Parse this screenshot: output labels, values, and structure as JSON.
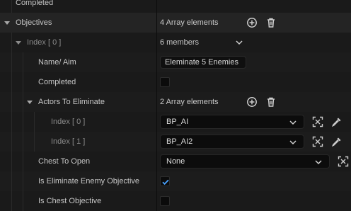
{
  "rows": {
    "completed_top": {
      "label": "Completed"
    },
    "objectives": {
      "label": "Objectives",
      "value": "4 Array elements"
    },
    "index0": {
      "label": "Index [ 0 ]",
      "value": "6 members"
    },
    "name_aim": {
      "label": "Name/ Aim",
      "value": "Eleminate 5 Enemies"
    },
    "completed": {
      "label": "Completed"
    },
    "actors": {
      "label": "Actors To Eliminate",
      "value": "2 Array elements"
    },
    "actor0": {
      "label": "Index [ 0 ]",
      "value": "BP_AI"
    },
    "actor1": {
      "label": "Index [ 1 ]",
      "value": "BP_AI2"
    },
    "chest": {
      "label": "Chest To Open",
      "value": "None"
    },
    "is_elim": {
      "label": "Is Eliminate Enemy Objective",
      "checked": true
    },
    "is_chest": {
      "label": "Is Chest Objective",
      "checked": false
    }
  },
  "icons": {
    "add": "add-element-icon",
    "delete": "trash-icon",
    "browse": "browse-to-asset-icon",
    "pick": "eyedropper-icon",
    "dropdown": "chevron-down-icon",
    "expand": "expand-arrow-icon"
  },
  "colors": {
    "accent": "#4aa3ff",
    "row": "#1a1a1a",
    "field": "#0f0f0f"
  }
}
